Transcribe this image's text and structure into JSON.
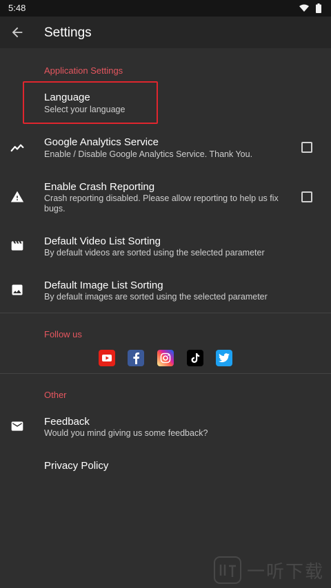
{
  "status": {
    "time": "5:48"
  },
  "header": {
    "title": "Settings"
  },
  "sections": {
    "app": "Application Settings",
    "follow": "Follow us",
    "other": "Other"
  },
  "prefs": {
    "language": {
      "title": "Language",
      "summary": "Select your language"
    },
    "analytics": {
      "title": "Google Analytics Service",
      "summary": "Enable / Disable Google Analytics Service. Thank You.",
      "checked": false
    },
    "crash": {
      "title": "Enable Crash Reporting",
      "summary": "Crash reporting disabled. Please allow reporting to help us fix bugs.",
      "checked": false
    },
    "video": {
      "title": "Default Video List Sorting",
      "summary": "By default videos are sorted using the selected parameter"
    },
    "image": {
      "title": "Default Image List Sorting",
      "summary": "By default images are sorted using the selected parameter"
    },
    "feedback": {
      "title": "Feedback",
      "summary": "Would you mind giving us some feedback?"
    },
    "privacy": {
      "title": "Privacy Policy"
    }
  },
  "social": [
    {
      "icon": "youtube-icon",
      "color": "#e62117"
    },
    {
      "icon": "facebook-icon",
      "color": "#3b5998"
    },
    {
      "icon": "instagram-icon",
      "color": "#d6249f"
    },
    {
      "icon": "tiktok-icon",
      "color": "#000000"
    },
    {
      "icon": "twitter-icon",
      "color": "#1da1f2"
    }
  ],
  "watermark": {
    "text": "一听下载"
  },
  "colors": {
    "accent": "#e5575f",
    "highlight": "#e0262e",
    "background": "#2f2f2f"
  }
}
